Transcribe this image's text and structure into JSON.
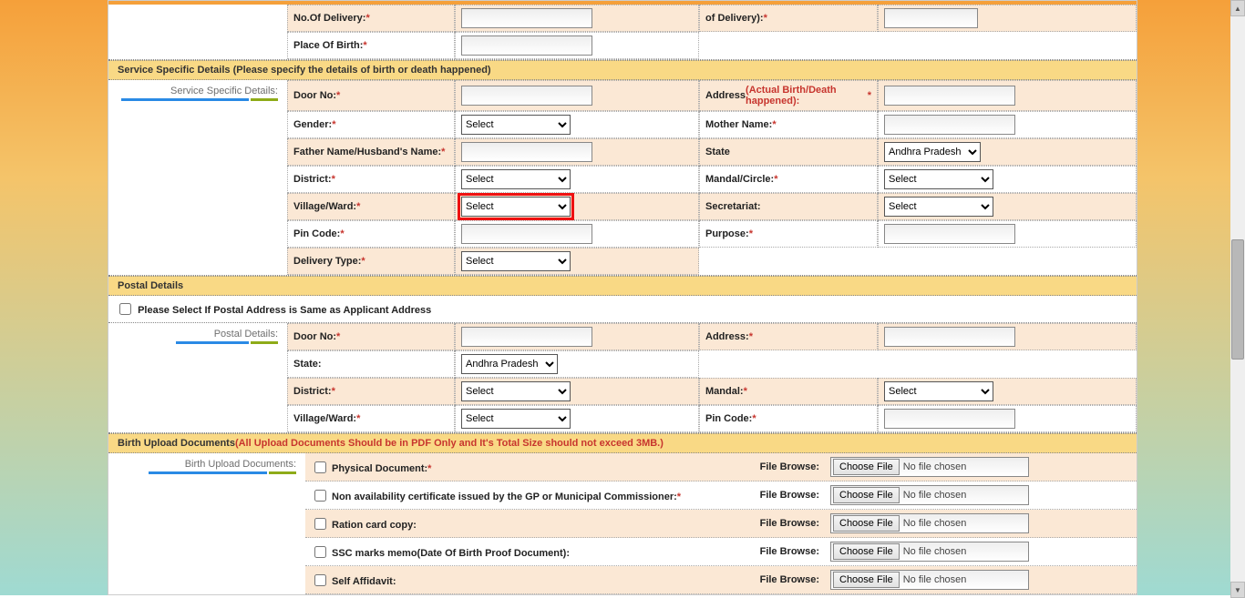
{
  "selectDefault": "Select",
  "stateDefault": "Andhra Pradesh",
  "fileBrowse": "File Browse:",
  "chooseFile": "Choose File",
  "noFile": "No file chosen",
  "top": {
    "noOfDelivery": "No.Of Delivery:",
    "placeOfBirth": "Place Of Birth:",
    "ofDeliveryTail": "of Delivery):"
  },
  "svc": {
    "header": "Service Specific Details (Please specify the details of birth or death happened)",
    "sideLabel": "Service Specific Details:",
    "doorNo": "Door No:",
    "address": "Address",
    "addressNote": "(Actual Birth/Death happened):",
    "gender": "Gender:",
    "motherName": "Mother Name:",
    "fatherHusband": "Father Name/Husband's Name:",
    "state": "State",
    "district": "District:",
    "mandalCircle": "Mandal/Circle:",
    "villageWard": "Village/Ward:",
    "secretariat": "Secretariat:",
    "pinCode": "Pin Code:",
    "purpose": "Purpose:",
    "deliveryType": "Delivery Type:"
  },
  "postal": {
    "header": "Postal Details",
    "sameAs": "Please Select If Postal Address is Same as Applicant Address",
    "sideLabel": "Postal Details:",
    "doorNo": "Door No:",
    "address": "Address:",
    "state": "State:",
    "district": "District:",
    "mandal": "Mandal:",
    "villageWard": "Village/Ward:",
    "pinCode": "Pin Code:"
  },
  "uploads": {
    "header": "Birth Upload Documents",
    "headerNote": "(All Upload Documents Should be in PDF Only and It's Total Size should not exceed 3MB.)",
    "sideLabel": "Birth Upload Documents:",
    "items": [
      {
        "label": "Physical Document:",
        "required": true
      },
      {
        "label": "Non availability certificate issued by the GP or Municipal Commissioner:",
        "required": true
      },
      {
        "label": "Ration card copy:",
        "required": false
      },
      {
        "label": "SSC marks memo(Date Of Birth Proof Document):",
        "required": false
      },
      {
        "label": "Self Affidavit:",
        "required": false
      }
    ]
  }
}
